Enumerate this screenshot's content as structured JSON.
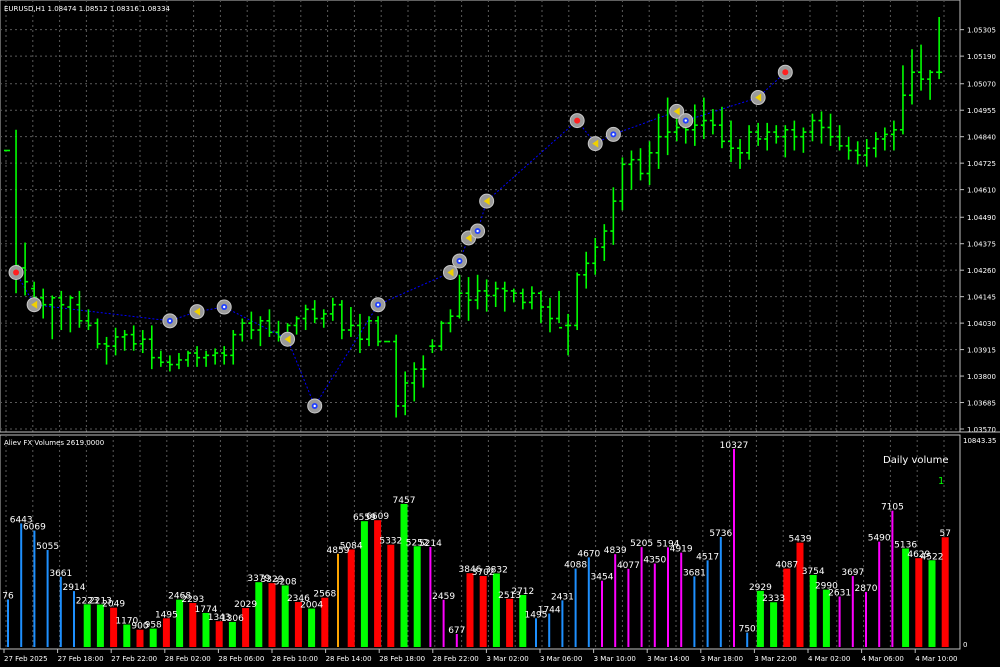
{
  "chart_data": [
    {
      "type": "ohlc",
      "title": "EURUSD,H1 1.08474 1.08512 1.08316 1.08334",
      "grid": true,
      "ylim": [
        1.0357,
        1.0536
      ],
      "y_ticks": [
        "1.05305",
        "1.05190",
        "1.05070",
        "1.04955",
        "1.04840",
        "1.04725",
        "1.04610",
        "1.04490",
        "1.04375",
        "1.04260",
        "1.04145",
        "1.04030",
        "1.03915",
        "1.03800",
        "1.03685",
        "1.03570"
      ],
      "bar_color": "#00ff00",
      "zigzag_color": "#0000ff",
      "bars": [
        {
          "o": 1.0478,
          "h": 1.0478,
          "l": 1.0478,
          "c": 1.0478
        },
        {
          "o": 1.0425,
          "h": 1.0487,
          "l": 1.0416,
          "c": 1.0428
        },
        {
          "o": 1.0427,
          "h": 1.0438,
          "l": 1.0415,
          "c": 1.0421
        },
        {
          "o": 1.0418,
          "h": 1.0421,
          "l": 1.0408,
          "c": 1.0414
        },
        {
          "o": 1.0414,
          "h": 1.0418,
          "l": 1.0405,
          "c": 1.0411
        },
        {
          "o": 1.0411,
          "h": 1.0415,
          "l": 1.0396,
          "c": 1.0414
        },
        {
          "o": 1.0414,
          "h": 1.0417,
          "l": 1.04,
          "c": 1.0411
        },
        {
          "o": 1.041,
          "h": 1.0415,
          "l": 1.0399,
          "c": 1.0414
        },
        {
          "o": 1.0411,
          "h": 1.0417,
          "l": 1.0401,
          "c": 1.0404
        },
        {
          "o": 1.0404,
          "h": 1.0409,
          "l": 1.04,
          "c": 1.0402
        },
        {
          "o": 1.0403,
          "h": 1.0405,
          "l": 1.0392,
          "c": 1.0394
        },
        {
          "o": 1.0394,
          "h": 1.0397,
          "l": 1.0385,
          "c": 1.0393
        },
        {
          "o": 1.0393,
          "h": 1.0401,
          "l": 1.0389,
          "c": 1.0397
        },
        {
          "o": 1.0397,
          "h": 1.04,
          "l": 1.0391,
          "c": 1.0398
        },
        {
          "o": 1.0398,
          "h": 1.0402,
          "l": 1.0391,
          "c": 1.0394
        },
        {
          "o": 1.0394,
          "h": 1.04,
          "l": 1.039,
          "c": 1.0396
        },
        {
          "o": 1.0396,
          "h": 1.0402,
          "l": 1.0383,
          "c": 1.0388
        },
        {
          "o": 1.0388,
          "h": 1.0391,
          "l": 1.0384,
          "c": 1.0386
        },
        {
          "o": 1.0386,
          "h": 1.0389,
          "l": 1.0382,
          "c": 1.0385
        },
        {
          "o": 1.0385,
          "h": 1.039,
          "l": 1.0383,
          "c": 1.0387
        },
        {
          "o": 1.0387,
          "h": 1.0391,
          "l": 1.0384,
          "c": 1.039
        },
        {
          "o": 1.039,
          "h": 1.0393,
          "l": 1.0384,
          "c": 1.0388
        },
        {
          "o": 1.0388,
          "h": 1.0391,
          "l": 1.0384,
          "c": 1.0389
        },
        {
          "o": 1.0389,
          "h": 1.0392,
          "l": 1.0385,
          "c": 1.039
        },
        {
          "o": 1.039,
          "h": 1.0393,
          "l": 1.0385,
          "c": 1.0389
        },
        {
          "o": 1.0389,
          "h": 1.04,
          "l": 1.0385,
          "c": 1.0398
        },
        {
          "o": 1.0398,
          "h": 1.0405,
          "l": 1.0395,
          "c": 1.0403
        },
        {
          "o": 1.0403,
          "h": 1.0408,
          "l": 1.0396,
          "c": 1.04
        },
        {
          "o": 1.04,
          "h": 1.0406,
          "l": 1.0393,
          "c": 1.0404
        },
        {
          "o": 1.0404,
          "h": 1.0409,
          "l": 1.0397,
          "c": 1.0399
        },
        {
          "o": 1.0399,
          "h": 1.0404,
          "l": 1.0395,
          "c": 1.0397
        },
        {
          "o": 1.0397,
          "h": 1.0403,
          "l": 1.0395,
          "c": 1.0402
        },
        {
          "o": 1.0402,
          "h": 1.0406,
          "l": 1.0398,
          "c": 1.0405
        },
        {
          "o": 1.0405,
          "h": 1.0411,
          "l": 1.04,
          "c": 1.0409
        },
        {
          "o": 1.0409,
          "h": 1.0413,
          "l": 1.0403,
          "c": 1.0405
        },
        {
          "o": 1.0405,
          "h": 1.0409,
          "l": 1.0401,
          "c": 1.0407
        },
        {
          "o": 1.0407,
          "h": 1.0414,
          "l": 1.0404,
          "c": 1.0411
        },
        {
          "o": 1.0411,
          "h": 1.0413,
          "l": 1.0396,
          "c": 1.04
        },
        {
          "o": 1.04,
          "h": 1.041,
          "l": 1.0397,
          "c": 1.0402
        },
        {
          "o": 1.0402,
          "h": 1.0407,
          "l": 1.039,
          "c": 1.0396
        },
        {
          "o": 1.0396,
          "h": 1.0406,
          "l": 1.0393,
          "c": 1.0404
        },
        {
          "o": 1.0404,
          "h": 1.0406,
          "l": 1.0393,
          "c": 1.0395
        },
        {
          "o": 1.0395,
          "h": 1.0395,
          "l": 1.0395,
          "c": 1.0395
        },
        {
          "o": 1.0395,
          "h": 1.0398,
          "l": 1.0362,
          "c": 1.0367
        },
        {
          "o": 1.0367,
          "h": 1.0382,
          "l": 1.0363,
          "c": 1.0377
        },
        {
          "o": 1.0377,
          "h": 1.0386,
          "l": 1.0369,
          "c": 1.0383
        },
        {
          "o": 1.0383,
          "h": 1.0389,
          "l": 1.0375,
          "c": 1.0383
        },
        {
          "o": 1.0393,
          "h": 1.0396,
          "l": 1.039,
          "c": 1.0393
        },
        {
          "o": 1.0393,
          "h": 1.0404,
          "l": 1.0391,
          "c": 1.0403
        },
        {
          "o": 1.0403,
          "h": 1.0409,
          "l": 1.0399,
          "c": 1.0406
        },
        {
          "o": 1.0406,
          "h": 1.0424,
          "l": 1.0405,
          "c": 1.0416
        },
        {
          "o": 1.0416,
          "h": 1.0423,
          "l": 1.0404,
          "c": 1.0413
        },
        {
          "o": 1.0413,
          "h": 1.0424,
          "l": 1.0409,
          "c": 1.0417
        },
        {
          "o": 1.0417,
          "h": 1.0422,
          "l": 1.0408,
          "c": 1.0415
        },
        {
          "o": 1.0415,
          "h": 1.0421,
          "l": 1.041,
          "c": 1.0418
        },
        {
          "o": 1.0418,
          "h": 1.0421,
          "l": 1.0408,
          "c": 1.0417
        },
        {
          "o": 1.0417,
          "h": 1.0418,
          "l": 1.0412,
          "c": 1.0416
        },
        {
          "o": 1.0416,
          "h": 1.0418,
          "l": 1.0409,
          "c": 1.0412
        },
        {
          "o": 1.0412,
          "h": 1.0419,
          "l": 1.0409,
          "c": 1.0416
        },
        {
          "o": 1.0416,
          "h": 1.0417,
          "l": 1.0403,
          "c": 1.041
        },
        {
          "o": 1.041,
          "h": 1.0414,
          "l": 1.0399,
          "c": 1.0405
        },
        {
          "o": 1.0405,
          "h": 1.0417,
          "l": 1.0403,
          "c": 1.0401
        },
        {
          "o": 1.0402,
          "h": 1.0407,
          "l": 1.0389,
          "c": 1.0402
        },
        {
          "o": 1.0402,
          "h": 1.0425,
          "l": 1.04,
          "c": 1.0424
        },
        {
          "o": 1.0424,
          "h": 1.0434,
          "l": 1.0418,
          "c": 1.0429
        },
        {
          "o": 1.0429,
          "h": 1.044,
          "l": 1.0424,
          "c": 1.0436
        },
        {
          "o": 1.0436,
          "h": 1.0446,
          "l": 1.043,
          "c": 1.0443
        },
        {
          "o": 1.0443,
          "h": 1.0462,
          "l": 1.0437,
          "c": 1.0456
        },
        {
          "o": 1.0456,
          "h": 1.0475,
          "l": 1.0452,
          "c": 1.0472
        },
        {
          "o": 1.0472,
          "h": 1.0478,
          "l": 1.0461,
          "c": 1.0474
        },
        {
          "o": 1.0474,
          "h": 1.0479,
          "l": 1.0465,
          "c": 1.0468
        },
        {
          "o": 1.0468,
          "h": 1.0482,
          "l": 1.0463,
          "c": 1.0477
        },
        {
          "o": 1.0477,
          "h": 1.0494,
          "l": 1.047,
          "c": 1.0484
        },
        {
          "o": 1.0484,
          "h": 1.0501,
          "l": 1.0476,
          "c": 1.0486
        },
        {
          "o": 1.0486,
          "h": 1.0495,
          "l": 1.0482,
          "c": 1.0488
        },
        {
          "o": 1.0488,
          "h": 1.0491,
          "l": 1.0481,
          "c": 1.0487
        },
        {
          "o": 1.0487,
          "h": 1.0498,
          "l": 1.048,
          "c": 1.0489
        },
        {
          "o": 1.0489,
          "h": 1.0501,
          "l": 1.0483,
          "c": 1.0491
        },
        {
          "o": 1.0491,
          "h": 1.0496,
          "l": 1.0485,
          "c": 1.0489
        },
        {
          "o": 1.0489,
          "h": 1.0497,
          "l": 1.0479,
          "c": 1.0482
        },
        {
          "o": 1.0482,
          "h": 1.0491,
          "l": 1.0473,
          "c": 1.0479
        },
        {
          "o": 1.0479,
          "h": 1.0483,
          "l": 1.047,
          "c": 1.0477
        },
        {
          "o": 1.0477,
          "h": 1.0489,
          "l": 1.0474,
          "c": 1.0486
        },
        {
          "o": 1.0486,
          "h": 1.049,
          "l": 1.048,
          "c": 1.0483
        },
        {
          "o": 1.0483,
          "h": 1.049,
          "l": 1.0478,
          "c": 1.0486
        },
        {
          "o": 1.0486,
          "h": 1.0489,
          "l": 1.0481,
          "c": 1.0484
        },
        {
          "o": 1.0484,
          "h": 1.0489,
          "l": 1.0475,
          "c": 1.0487
        },
        {
          "o": 1.0487,
          "h": 1.0491,
          "l": 1.0478,
          "c": 1.0484
        },
        {
          "o": 1.0484,
          "h": 1.0488,
          "l": 1.0477,
          "c": 1.0486
        },
        {
          "o": 1.0486,
          "h": 1.0494,
          "l": 1.0482,
          "c": 1.0491
        },
        {
          "o": 1.0491,
          "h": 1.0495,
          "l": 1.0481,
          "c": 1.0488
        },
        {
          "o": 1.0488,
          "h": 1.0494,
          "l": 1.048,
          "c": 1.0484
        },
        {
          "o": 1.0484,
          "h": 1.0489,
          "l": 1.0478,
          "c": 1.048
        },
        {
          "o": 1.048,
          "h": 1.0484,
          "l": 1.0474,
          "c": 1.0478
        },
        {
          "o": 1.0478,
          "h": 1.0482,
          "l": 1.0472,
          "c": 1.0476
        },
        {
          "o": 1.0476,
          "h": 1.0483,
          "l": 1.0471,
          "c": 1.0479
        },
        {
          "o": 1.0479,
          "h": 1.0486,
          "l": 1.0475,
          "c": 1.0483
        },
        {
          "o": 1.0483,
          "h": 1.0488,
          "l": 1.0478,
          "c": 1.0485
        },
        {
          "o": 1.0485,
          "h": 1.0491,
          "l": 1.0478,
          "c": 1.0487
        },
        {
          "o": 1.0487,
          "h": 1.0515,
          "l": 1.0485,
          "c": 1.0502
        },
        {
          "o": 1.0502,
          "h": 1.0522,
          "l": 1.0498,
          "c": 1.0512
        },
        {
          "o": 1.0512,
          "h": 1.0524,
          "l": 1.0504,
          "c": 1.0509
        },
        {
          "o": 1.0509,
          "h": 1.0513,
          "l": 1.05,
          "c": 1.0512
        },
        {
          "o": 1.0512,
          "h": 1.0536,
          "l": 1.0509,
          "c": 1.0512
        }
      ],
      "markers": [
        {
          "bar": 1,
          "price": 1.0425,
          "kind": "sell"
        },
        {
          "bar": 3,
          "price": 1.0411,
          "kind": "neutral"
        },
        {
          "bar": 18,
          "price": 1.0404,
          "kind": "buy"
        },
        {
          "bar": 21,
          "price": 1.0408,
          "kind": "neutral"
        },
        {
          "bar": 24,
          "price": 1.041,
          "kind": "buy"
        },
        {
          "bar": 31,
          "price": 1.0396,
          "kind": "neutral"
        },
        {
          "bar": 34,
          "price": 1.0367,
          "kind": "buy"
        },
        {
          "bar": 41,
          "price": 1.0411,
          "kind": "buy"
        },
        {
          "bar": 49,
          "price": 1.0425,
          "kind": "neutral"
        },
        {
          "bar": 50,
          "price": 1.043,
          "kind": "buy"
        },
        {
          "bar": 51,
          "price": 1.044,
          "kind": "neutral"
        },
        {
          "bar": 52,
          "price": 1.0443,
          "kind": "buy"
        },
        {
          "bar": 53,
          "price": 1.0456,
          "kind": "neutral"
        },
        {
          "bar": 63,
          "price": 1.0491,
          "kind": "sell"
        },
        {
          "bar": 65,
          "price": 1.0481,
          "kind": "neutral"
        },
        {
          "bar": 67,
          "price": 1.0485,
          "kind": "buy"
        },
        {
          "bar": 74,
          "price": 1.0495,
          "kind": "neutral"
        },
        {
          "bar": 75,
          "price": 1.0491,
          "kind": "buy"
        },
        {
          "bar": 83,
          "price": 1.0501,
          "kind": "neutral"
        },
        {
          "bar": 86,
          "price": 1.0512,
          "kind": "sell"
        }
      ]
    },
    {
      "type": "bar",
      "title": "Aliev FX Volumes 2619.0000",
      "annotation": "Daily volume",
      "annotation_value": "1",
      "ylim": [
        0,
        10843.35
      ],
      "y_ticks": [
        "10843.35",
        "0"
      ],
      "x_ticks": [
        "27 Feb 2025",
        "27 Feb 18:00",
        "27 Feb 22:00",
        "28 Feb 02:00",
        "28 Feb 06:00",
        "28 Feb 10:00",
        "28 Feb 14:00",
        "28 Feb 18:00",
        "28 Feb 22:00",
        "3 Mar 02:00",
        "3 Mar 06:00",
        "3 Mar 10:00",
        "3 Mar 14:00",
        "3 Mar 18:00",
        "3 Mar 22:00",
        "4 Mar 02:00",
        "4 Mar 06:00",
        "4 Mar 10:00"
      ],
      "colors": {
        "up": "#00ff00",
        "down": "#ff0000",
        "blue": "#1e90ff",
        "magenta": "#ff00ff",
        "orange": "#ffa500"
      },
      "values": [
        2476,
        6443,
        6069,
        5055,
        3661,
        2914,
        2223,
        2213,
        2049,
        1170,
        900,
        958,
        1495,
        2468,
        2293,
        1774,
        1343,
        1306,
        2029,
        3379,
        3329,
        3208,
        2346,
        2004,
        2568,
        4859,
        5084,
        6559,
        6609,
        5332,
        7457,
        5252,
        5214,
        2459,
        677,
        3846,
        3702,
        3832,
        2513,
        2712,
        1495,
        1744,
        2431,
        4088,
        4670,
        3454,
        4839,
        4077,
        5205,
        4350,
        5194,
        4919,
        3681,
        4517,
        5736,
        10327,
        750,
        2929,
        2333,
        4087,
        5439,
        3754,
        2990,
        2631,
        3697,
        2870,
        5490,
        7105,
        5136,
        4629,
        4522,
        5722
      ],
      "labels": [
        "76",
        "6443",
        "6069",
        "5055",
        "3661",
        "2914",
        "2223",
        "2213",
        "2049",
        "1170",
        "900",
        "958",
        "1495",
        "2468",
        "2293",
        "1774",
        "1343",
        "1306",
        "2029",
        "3379",
        "3329",
        "3208",
        "2346",
        "2004",
        "2568",
        "4859",
        "5084",
        "6559",
        "6609",
        "5332",
        "7457",
        "5252",
        "5214",
        "2459",
        "677",
        "3846",
        "3702",
        "3832",
        "2513",
        "2712",
        "1495",
        "1744",
        "2431",
        "4088",
        "4670",
        "3454",
        "4839",
        "4077",
        "5205",
        "4350",
        "5194",
        "4919",
        "3681",
        "4517",
        "5736",
        "10327",
        "750",
        "2929",
        "2333",
        "4087",
        "5439",
        "3754",
        "2990",
        "2631",
        "3697",
        "2870",
        "5490",
        "7105",
        "5136",
        "4629",
        "4522",
        "57"
      ],
      "bar_colors": [
        "blue",
        "blue",
        "blue",
        "blue",
        "blue",
        "blue",
        "up",
        "up",
        "down",
        "up",
        "down",
        "up",
        "down",
        "up",
        "down",
        "up",
        "down",
        "up",
        "down",
        "up",
        "down",
        "up",
        "down",
        "up",
        "down",
        "orange",
        "down",
        "up",
        "down",
        "down",
        "up",
        "up",
        "magenta",
        "magenta",
        "magenta",
        "down",
        "down",
        "up",
        "down",
        "up",
        "blue",
        "blue",
        "blue",
        "blue",
        "blue",
        "magenta",
        "magenta",
        "magenta",
        "magenta",
        "magenta",
        "magenta",
        "magenta",
        "blue",
        "blue",
        "blue",
        "magenta",
        "blue",
        "up",
        "up",
        "down",
        "down",
        "up",
        "up",
        "magenta",
        "magenta",
        "magenta",
        "magenta",
        "magenta",
        "up",
        "down",
        "up",
        "down"
      ]
    }
  ]
}
